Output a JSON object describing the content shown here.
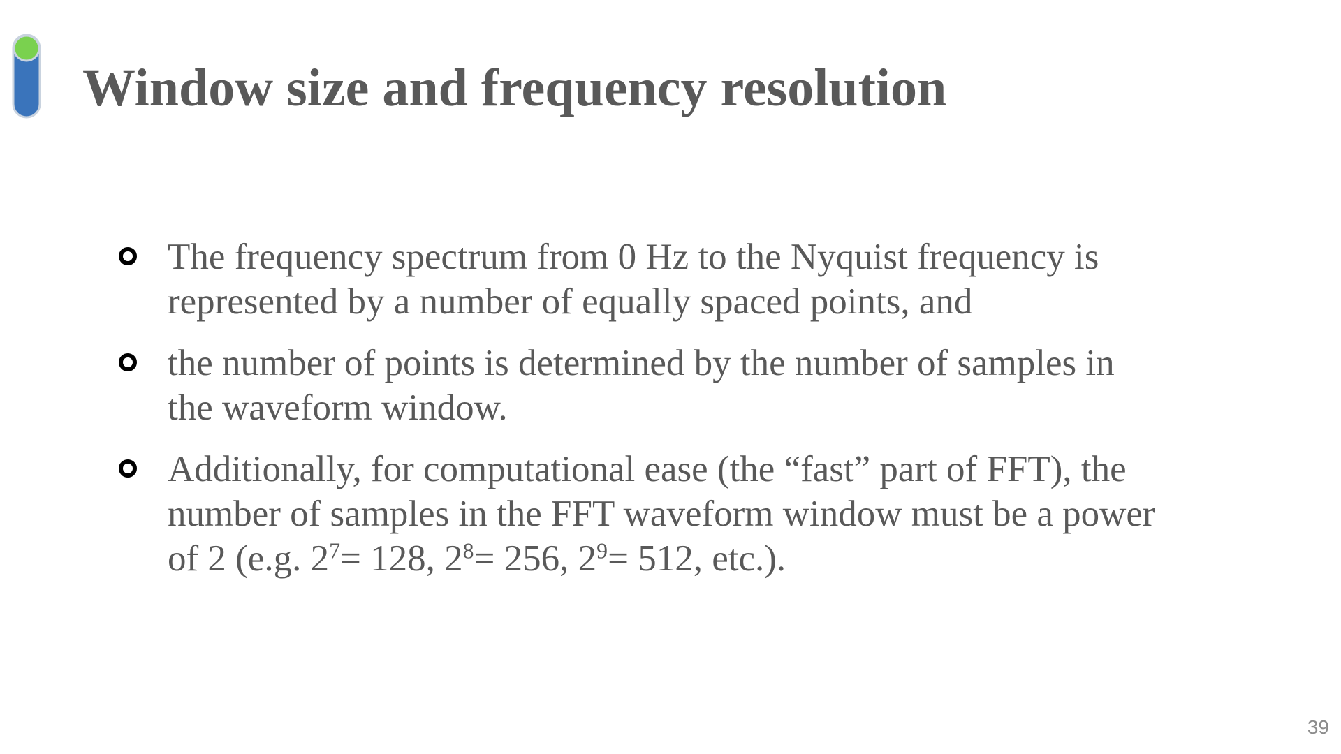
{
  "slide": {
    "title": "Window size and frequency resolution",
    "page_number": "39",
    "logo": {
      "icon": "toggle-pill-icon",
      "colors": {
        "body": "#3a74bb",
        "knob": "#7ad14f",
        "outline": "#c9d3df"
      }
    },
    "bullets": [
      {
        "lines": [
          "The frequency spectrum from 0 Hz to the Nyquist frequency is",
          "represented by a number of equally spaced points, and"
        ]
      },
      {
        "lines": [
          "the number of points is determined by the number of samples in",
          "the waveform window."
        ]
      },
      {
        "lines": [
          "Additionally, for computational ease (the “fast” part of FFT), the",
          "number of samples in the FFT waveform window must be a power"
        ],
        "last_line": {
          "prefix": "of 2 (e.g. 2",
          "exp1": "7",
          "mid1": "= 128, 2",
          "exp2": "8",
          "mid2": "= 256, 2",
          "exp3": "9",
          "suffix": "= 512, etc.)."
        }
      }
    ]
  }
}
